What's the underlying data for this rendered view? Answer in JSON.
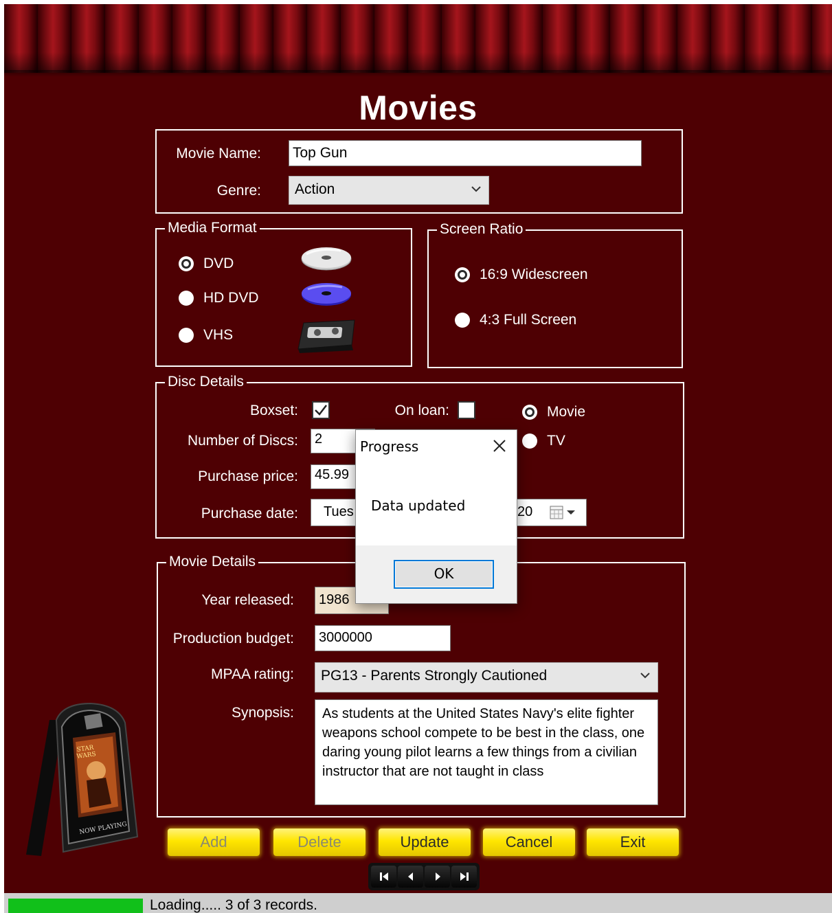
{
  "title": "Movies",
  "movie": {
    "name_label": "Movie Name:",
    "name_value": "Top Gun",
    "genre_label": "Genre:",
    "genre_value": "Action"
  },
  "media_format": {
    "legend": "Media Format",
    "options": [
      {
        "label": "DVD",
        "selected": true,
        "icon": "dvd-disc-icon"
      },
      {
        "label": "HD DVD",
        "selected": false,
        "icon": "hd-dvd-disc-icon"
      },
      {
        "label": "VHS",
        "selected": false,
        "icon": "vhs-tape-icon"
      }
    ]
  },
  "screen_ratio": {
    "legend": "Screen Ratio",
    "options": [
      {
        "label": "16:9 Widescreen",
        "selected": true
      },
      {
        "label": "4:3 Full Screen",
        "selected": false
      }
    ]
  },
  "disc_details": {
    "legend": "Disc Details",
    "boxset_label": "Boxset:",
    "boxset_checked": true,
    "onloan_label": "On loan:",
    "onloan_checked": false,
    "type_options": [
      {
        "label": "Movie",
        "selected": true
      },
      {
        "label": "TV",
        "selected": false
      }
    ],
    "num_discs_label": "Number of Discs:",
    "num_discs_value": "2",
    "price_label": "Purchase price:",
    "price_value": "45.99",
    "date_label": "Purchase date:",
    "date_value_visible_left": "Tues",
    "date_value_visible_right": "20"
  },
  "movie_details": {
    "legend": "Movie Details",
    "year_label": "Year released:",
    "year_value": "1986",
    "budget_label": "Production budget:",
    "budget_value": "3000000",
    "mpaa_label": "MPAA rating:",
    "mpaa_value": "PG13 - Parents Strongly Cautioned",
    "synopsis_label": "Synopsis:",
    "synopsis_value": "As students at the United States Navy's elite fighter weapons school compete to be best in the class, one daring young pilot learns a few things from a civilian instructor that are not taught in class"
  },
  "buttons": {
    "add": "Add",
    "delete": "Delete",
    "update": "Update",
    "cancel": "Cancel",
    "exit": "Exit"
  },
  "status": {
    "text": "Loading..... 3 of 3 records."
  },
  "dialog": {
    "title": "Progress",
    "message": "Data updated",
    "ok": "OK"
  },
  "colors": {
    "background": "#4e0003",
    "button_yellow": "#ffe600",
    "progress_green": "#11c01a",
    "dialog_focus": "#0078d7"
  }
}
